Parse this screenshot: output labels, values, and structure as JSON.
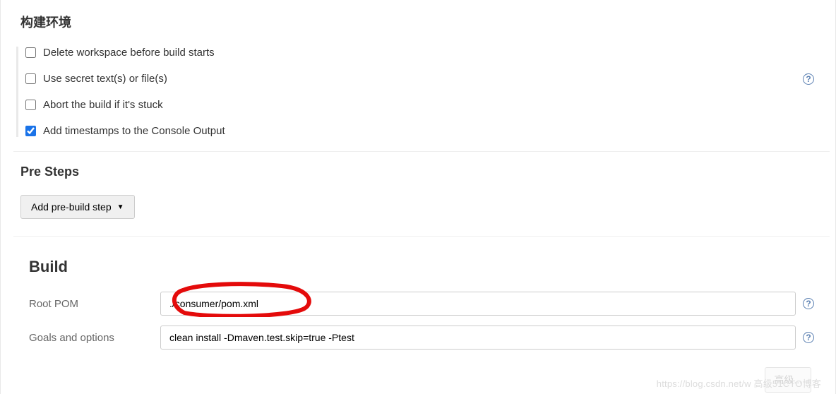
{
  "sections": {
    "build_env_title": "构建环境",
    "pre_steps_title": "Pre Steps",
    "build_title": "Build"
  },
  "env_checks": [
    {
      "label": "Delete workspace before build starts",
      "checked": false,
      "has_help": false
    },
    {
      "label": "Use secret text(s) or file(s)",
      "checked": false,
      "has_help": true
    },
    {
      "label": "Abort the build if it's stuck",
      "checked": false,
      "has_help": false
    },
    {
      "label": "Add timestamps to the Console Output",
      "checked": true,
      "has_help": false
    }
  ],
  "buttons": {
    "add_pre_build": "Add pre-build step",
    "advanced": "高级..."
  },
  "build_fields": {
    "root_pom_label": "Root POM",
    "root_pom_value": "./consumer/pom.xml",
    "goals_label": "Goals and options",
    "goals_value": "clean install -Dmaven.test.skip=true -Ptest"
  },
  "help_glyph": "?",
  "watermark": "https://blog.csdn.net/w 高级51CTO博客"
}
